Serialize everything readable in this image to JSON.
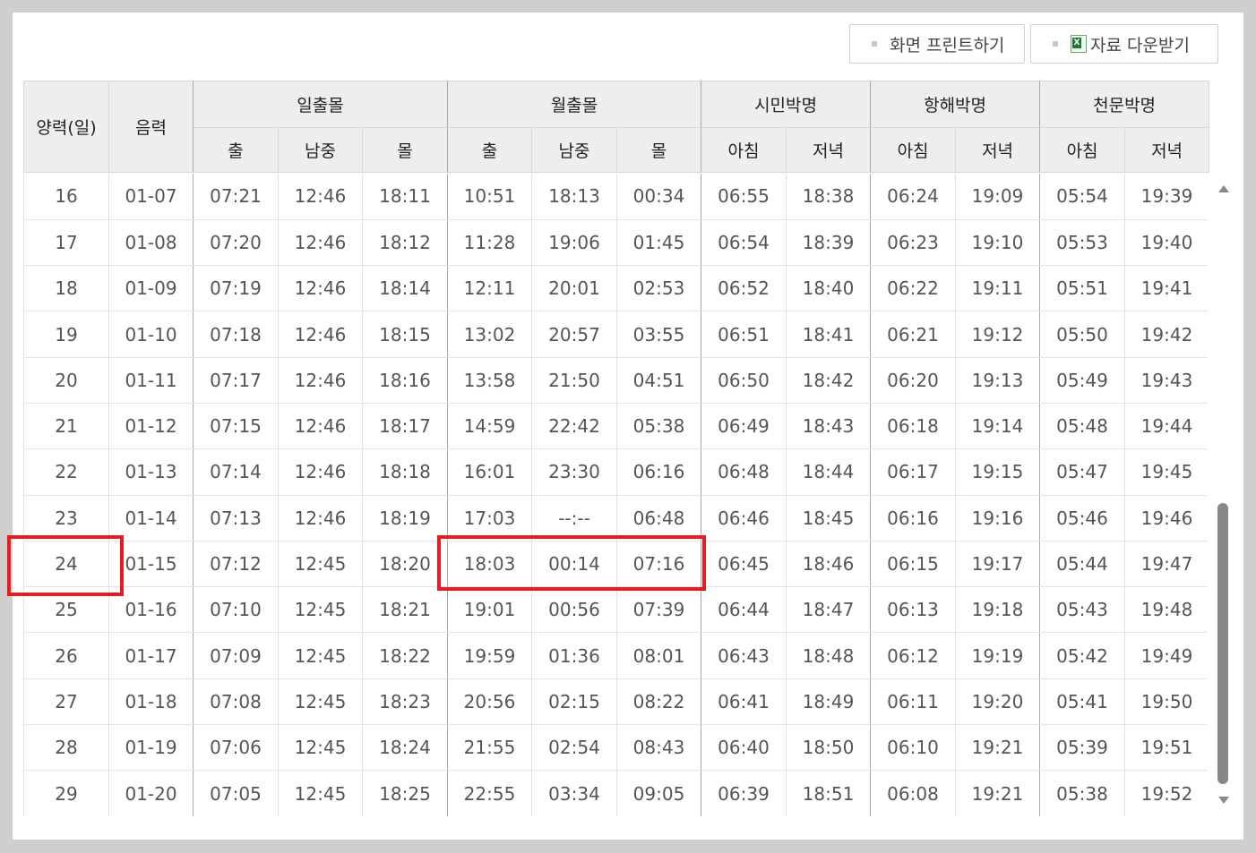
{
  "buttons": {
    "print": "화면 프린트하기",
    "download": "자료 다운받기",
    "download_icon": "excel-file-icon"
  },
  "header": {
    "solar_day": "양력(일)",
    "lunar": "음력",
    "sun_group": "일출몰",
    "moon_group": "월출몰",
    "civil_twilight": "시민박명",
    "nautical_twilight": "항해박명",
    "astronomical_twilight": "천문박명",
    "rise": "출",
    "transit": "남중",
    "set": "몰",
    "morning": "아침",
    "evening": "저녁"
  },
  "highlight_color": "#e31d25",
  "rows": [
    {
      "day": "16",
      "lunar": "01-07",
      "sun_rise": "07:21",
      "sun_transit": "12:46",
      "sun_set": "18:11",
      "moon_rise": "10:51",
      "moon_transit": "18:13",
      "moon_set": "00:34",
      "civil_am": "06:55",
      "civil_pm": "18:38",
      "naut_am": "06:24",
      "naut_pm": "19:09",
      "astro_am": "05:54",
      "astro_pm": "19:39"
    },
    {
      "day": "17",
      "lunar": "01-08",
      "sun_rise": "07:20",
      "sun_transit": "12:46",
      "sun_set": "18:12",
      "moon_rise": "11:28",
      "moon_transit": "19:06",
      "moon_set": "01:45",
      "civil_am": "06:54",
      "civil_pm": "18:39",
      "naut_am": "06:23",
      "naut_pm": "19:10",
      "astro_am": "05:53",
      "astro_pm": "19:40"
    },
    {
      "day": "18",
      "lunar": "01-09",
      "sun_rise": "07:19",
      "sun_transit": "12:46",
      "sun_set": "18:14",
      "moon_rise": "12:11",
      "moon_transit": "20:01",
      "moon_set": "02:53",
      "civil_am": "06:52",
      "civil_pm": "18:40",
      "naut_am": "06:22",
      "naut_pm": "19:11",
      "astro_am": "05:51",
      "astro_pm": "19:41"
    },
    {
      "day": "19",
      "lunar": "01-10",
      "sun_rise": "07:18",
      "sun_transit": "12:46",
      "sun_set": "18:15",
      "moon_rise": "13:02",
      "moon_transit": "20:57",
      "moon_set": "03:55",
      "civil_am": "06:51",
      "civil_pm": "18:41",
      "naut_am": "06:21",
      "naut_pm": "19:12",
      "astro_am": "05:50",
      "astro_pm": "19:42"
    },
    {
      "day": "20",
      "lunar": "01-11",
      "sun_rise": "07:17",
      "sun_transit": "12:46",
      "sun_set": "18:16",
      "moon_rise": "13:58",
      "moon_transit": "21:50",
      "moon_set": "04:51",
      "civil_am": "06:50",
      "civil_pm": "18:42",
      "naut_am": "06:20",
      "naut_pm": "19:13",
      "astro_am": "05:49",
      "astro_pm": "19:43"
    },
    {
      "day": "21",
      "lunar": "01-12",
      "sun_rise": "07:15",
      "sun_transit": "12:46",
      "sun_set": "18:17",
      "moon_rise": "14:59",
      "moon_transit": "22:42",
      "moon_set": "05:38",
      "civil_am": "06:49",
      "civil_pm": "18:43",
      "naut_am": "06:18",
      "naut_pm": "19:14",
      "astro_am": "05:48",
      "astro_pm": "19:44"
    },
    {
      "day": "22",
      "lunar": "01-13",
      "sun_rise": "07:14",
      "sun_transit": "12:46",
      "sun_set": "18:18",
      "moon_rise": "16:01",
      "moon_transit": "23:30",
      "moon_set": "06:16",
      "civil_am": "06:48",
      "civil_pm": "18:44",
      "naut_am": "06:17",
      "naut_pm": "19:15",
      "astro_am": "05:47",
      "astro_pm": "19:45"
    },
    {
      "day": "23",
      "lunar": "01-14",
      "sun_rise": "07:13",
      "sun_transit": "12:46",
      "sun_set": "18:19",
      "moon_rise": "17:03",
      "moon_transit": "--:--",
      "moon_set": "06:48",
      "civil_am": "06:46",
      "civil_pm": "18:45",
      "naut_am": "06:16",
      "naut_pm": "19:16",
      "astro_am": "05:46",
      "astro_pm": "19:46"
    },
    {
      "day": "24",
      "lunar": "01-15",
      "sun_rise": "07:12",
      "sun_transit": "12:45",
      "sun_set": "18:20",
      "moon_rise": "18:03",
      "moon_transit": "00:14",
      "moon_set": "07:16",
      "civil_am": "06:45",
      "civil_pm": "18:46",
      "naut_am": "06:15",
      "naut_pm": "19:17",
      "astro_am": "05:44",
      "astro_pm": "19:47"
    },
    {
      "day": "25",
      "lunar": "01-16",
      "sun_rise": "07:10",
      "sun_transit": "12:45",
      "sun_set": "18:21",
      "moon_rise": "19:01",
      "moon_transit": "00:56",
      "moon_set": "07:39",
      "civil_am": "06:44",
      "civil_pm": "18:47",
      "naut_am": "06:13",
      "naut_pm": "19:18",
      "astro_am": "05:43",
      "astro_pm": "19:48"
    },
    {
      "day": "26",
      "lunar": "01-17",
      "sun_rise": "07:09",
      "sun_transit": "12:45",
      "sun_set": "18:22",
      "moon_rise": "19:59",
      "moon_transit": "01:36",
      "moon_set": "08:01",
      "civil_am": "06:43",
      "civil_pm": "18:48",
      "naut_am": "06:12",
      "naut_pm": "19:19",
      "astro_am": "05:42",
      "astro_pm": "19:49"
    },
    {
      "day": "27",
      "lunar": "01-18",
      "sun_rise": "07:08",
      "sun_transit": "12:45",
      "sun_set": "18:23",
      "moon_rise": "20:56",
      "moon_transit": "02:15",
      "moon_set": "08:22",
      "civil_am": "06:41",
      "civil_pm": "18:49",
      "naut_am": "06:11",
      "naut_pm": "19:20",
      "astro_am": "05:41",
      "astro_pm": "19:50"
    },
    {
      "day": "28",
      "lunar": "01-19",
      "sun_rise": "07:06",
      "sun_transit": "12:45",
      "sun_set": "18:24",
      "moon_rise": "21:55",
      "moon_transit": "02:54",
      "moon_set": "08:43",
      "civil_am": "06:40",
      "civil_pm": "18:50",
      "naut_am": "06:10",
      "naut_pm": "19:21",
      "astro_am": "05:39",
      "astro_pm": "19:51"
    },
    {
      "day": "29",
      "lunar": "01-20",
      "sun_rise": "07:05",
      "sun_transit": "12:45",
      "sun_set": "18:25",
      "moon_rise": "22:55",
      "moon_transit": "03:34",
      "moon_set": "09:05",
      "civil_am": "06:39",
      "civil_pm": "18:51",
      "naut_am": "06:08",
      "naut_pm": "19:21",
      "astro_am": "05:38",
      "astro_pm": "19:52"
    }
  ]
}
